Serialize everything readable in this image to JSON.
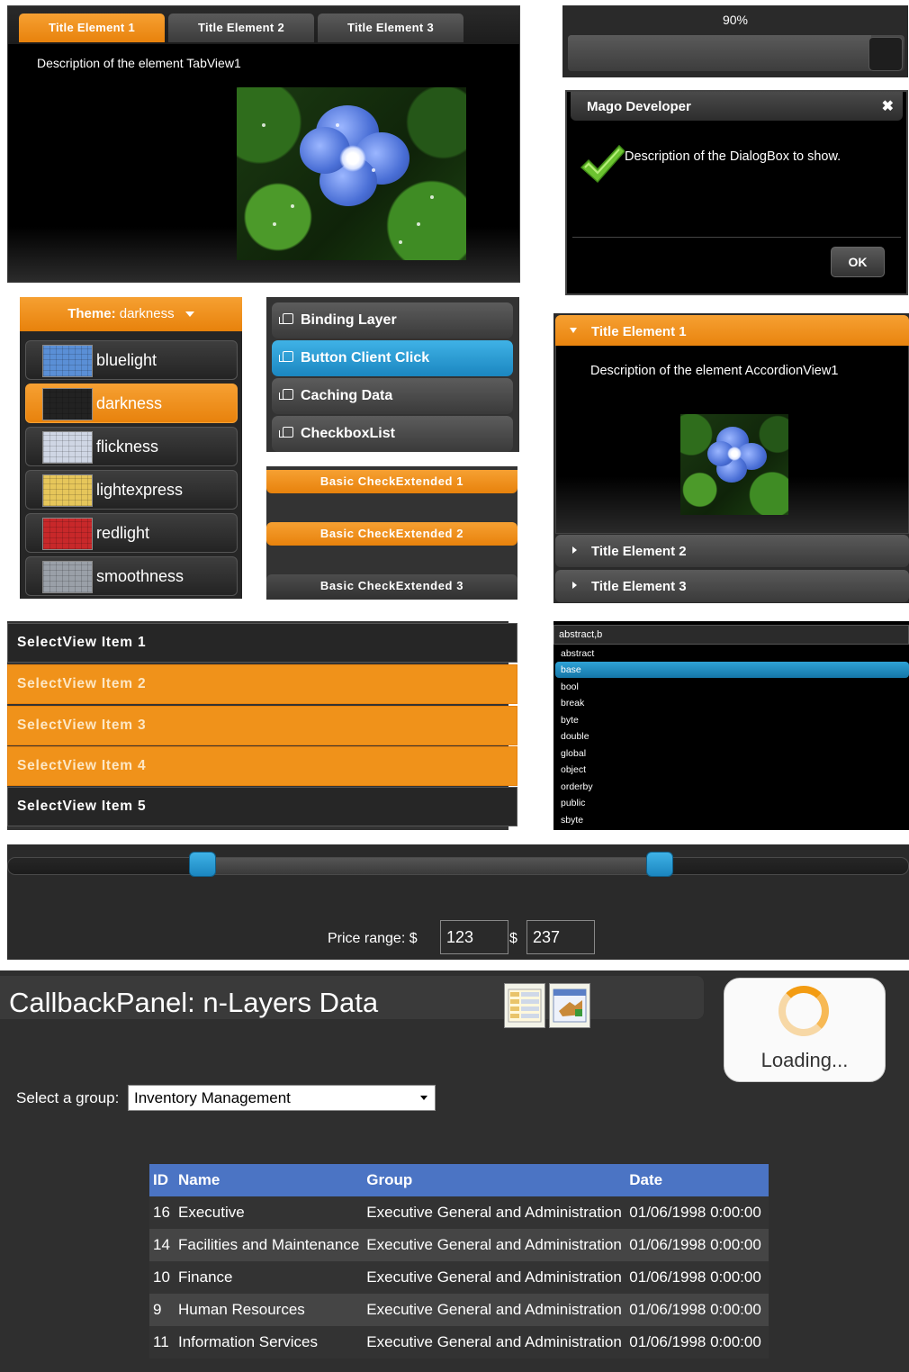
{
  "tabview": {
    "tabs": [
      "Title Element 1",
      "Title Element 2",
      "Title Element 3"
    ],
    "active_tab": 0,
    "description": "Description of the element TabView1",
    "image_subject": "blue-flower-photo"
  },
  "progress": {
    "label": "90%",
    "value": 0.9
  },
  "dialog": {
    "title": "Mago Developer",
    "close_glyph": "✖",
    "message": "Description of the DialogBox to show.",
    "icon": "checkmark-icon",
    "ok_label": "OK"
  },
  "theme_selector": {
    "header_prefix": "Theme:",
    "header_value": "darkness",
    "items": [
      "bluelight",
      "darkness",
      "flickness",
      "lightexpress",
      "redlight",
      "smoothness"
    ],
    "selected": "darkness",
    "thumb_colors": [
      "#5a8fd6",
      "#222222",
      "#cfd6e4",
      "#e6c65a",
      "#c8282a",
      "#9aa0a8"
    ]
  },
  "button_list": {
    "items": [
      "Binding Layer",
      "Button Client Click",
      "Caching Data",
      "CheckboxList"
    ],
    "selected": "Button Client Click"
  },
  "check_extended": {
    "items": [
      {
        "label": "Basic CheckExtended 1",
        "checked": true
      },
      {
        "label": "Basic CheckExtended 2",
        "checked": true
      },
      {
        "label": "Basic CheckExtended 3",
        "checked": false
      }
    ]
  },
  "accordion": {
    "items": [
      "Title Element 1",
      "Title Element 2",
      "Title Element 3"
    ],
    "open_index": 0,
    "description": "Description of the element AccordionView1"
  },
  "selectview": {
    "items": [
      {
        "label": "SelectView Item 1",
        "selected": false
      },
      {
        "label": "SelectView Item 2",
        "selected": true
      },
      {
        "label": "SelectView Item 3",
        "selected": true
      },
      {
        "label": "SelectView Item 4",
        "selected": true
      },
      {
        "label": "SelectView Item 5",
        "selected": false
      }
    ]
  },
  "autocomplete": {
    "input_value": "abstract,b",
    "items": [
      "abstract",
      "base",
      "bool",
      "break",
      "byte",
      "double",
      "global",
      "object",
      "orderby",
      "public",
      "sbyte"
    ],
    "selected": "base"
  },
  "range_slider": {
    "label": "Price range:",
    "currency": "$",
    "low": "123",
    "high": "237"
  },
  "callback_panel": {
    "title": "CallbackPanel: n-Layers Data",
    "loading_text": "Loading...",
    "group_label": "Select a group:",
    "group_value": "Inventory Management",
    "columns": [
      "ID",
      "Name",
      "Group",
      "Date"
    ],
    "rows": [
      [
        "16",
        "Executive",
        "Executive General and Administration",
        "01/06/1998 0:00:00"
      ],
      [
        "14",
        "Facilities and Maintenance",
        "Executive General and Administration",
        "01/06/1998 0:00:00"
      ],
      [
        "10",
        "Finance",
        "Executive General and Administration",
        "01/06/1998 0:00:00"
      ],
      [
        "9",
        "Human Resources",
        "Executive General and Administration",
        "01/06/1998 0:00:00"
      ],
      [
        "11",
        "Information Services",
        "Executive General and Administration",
        "01/06/1998 0:00:00"
      ]
    ]
  }
}
